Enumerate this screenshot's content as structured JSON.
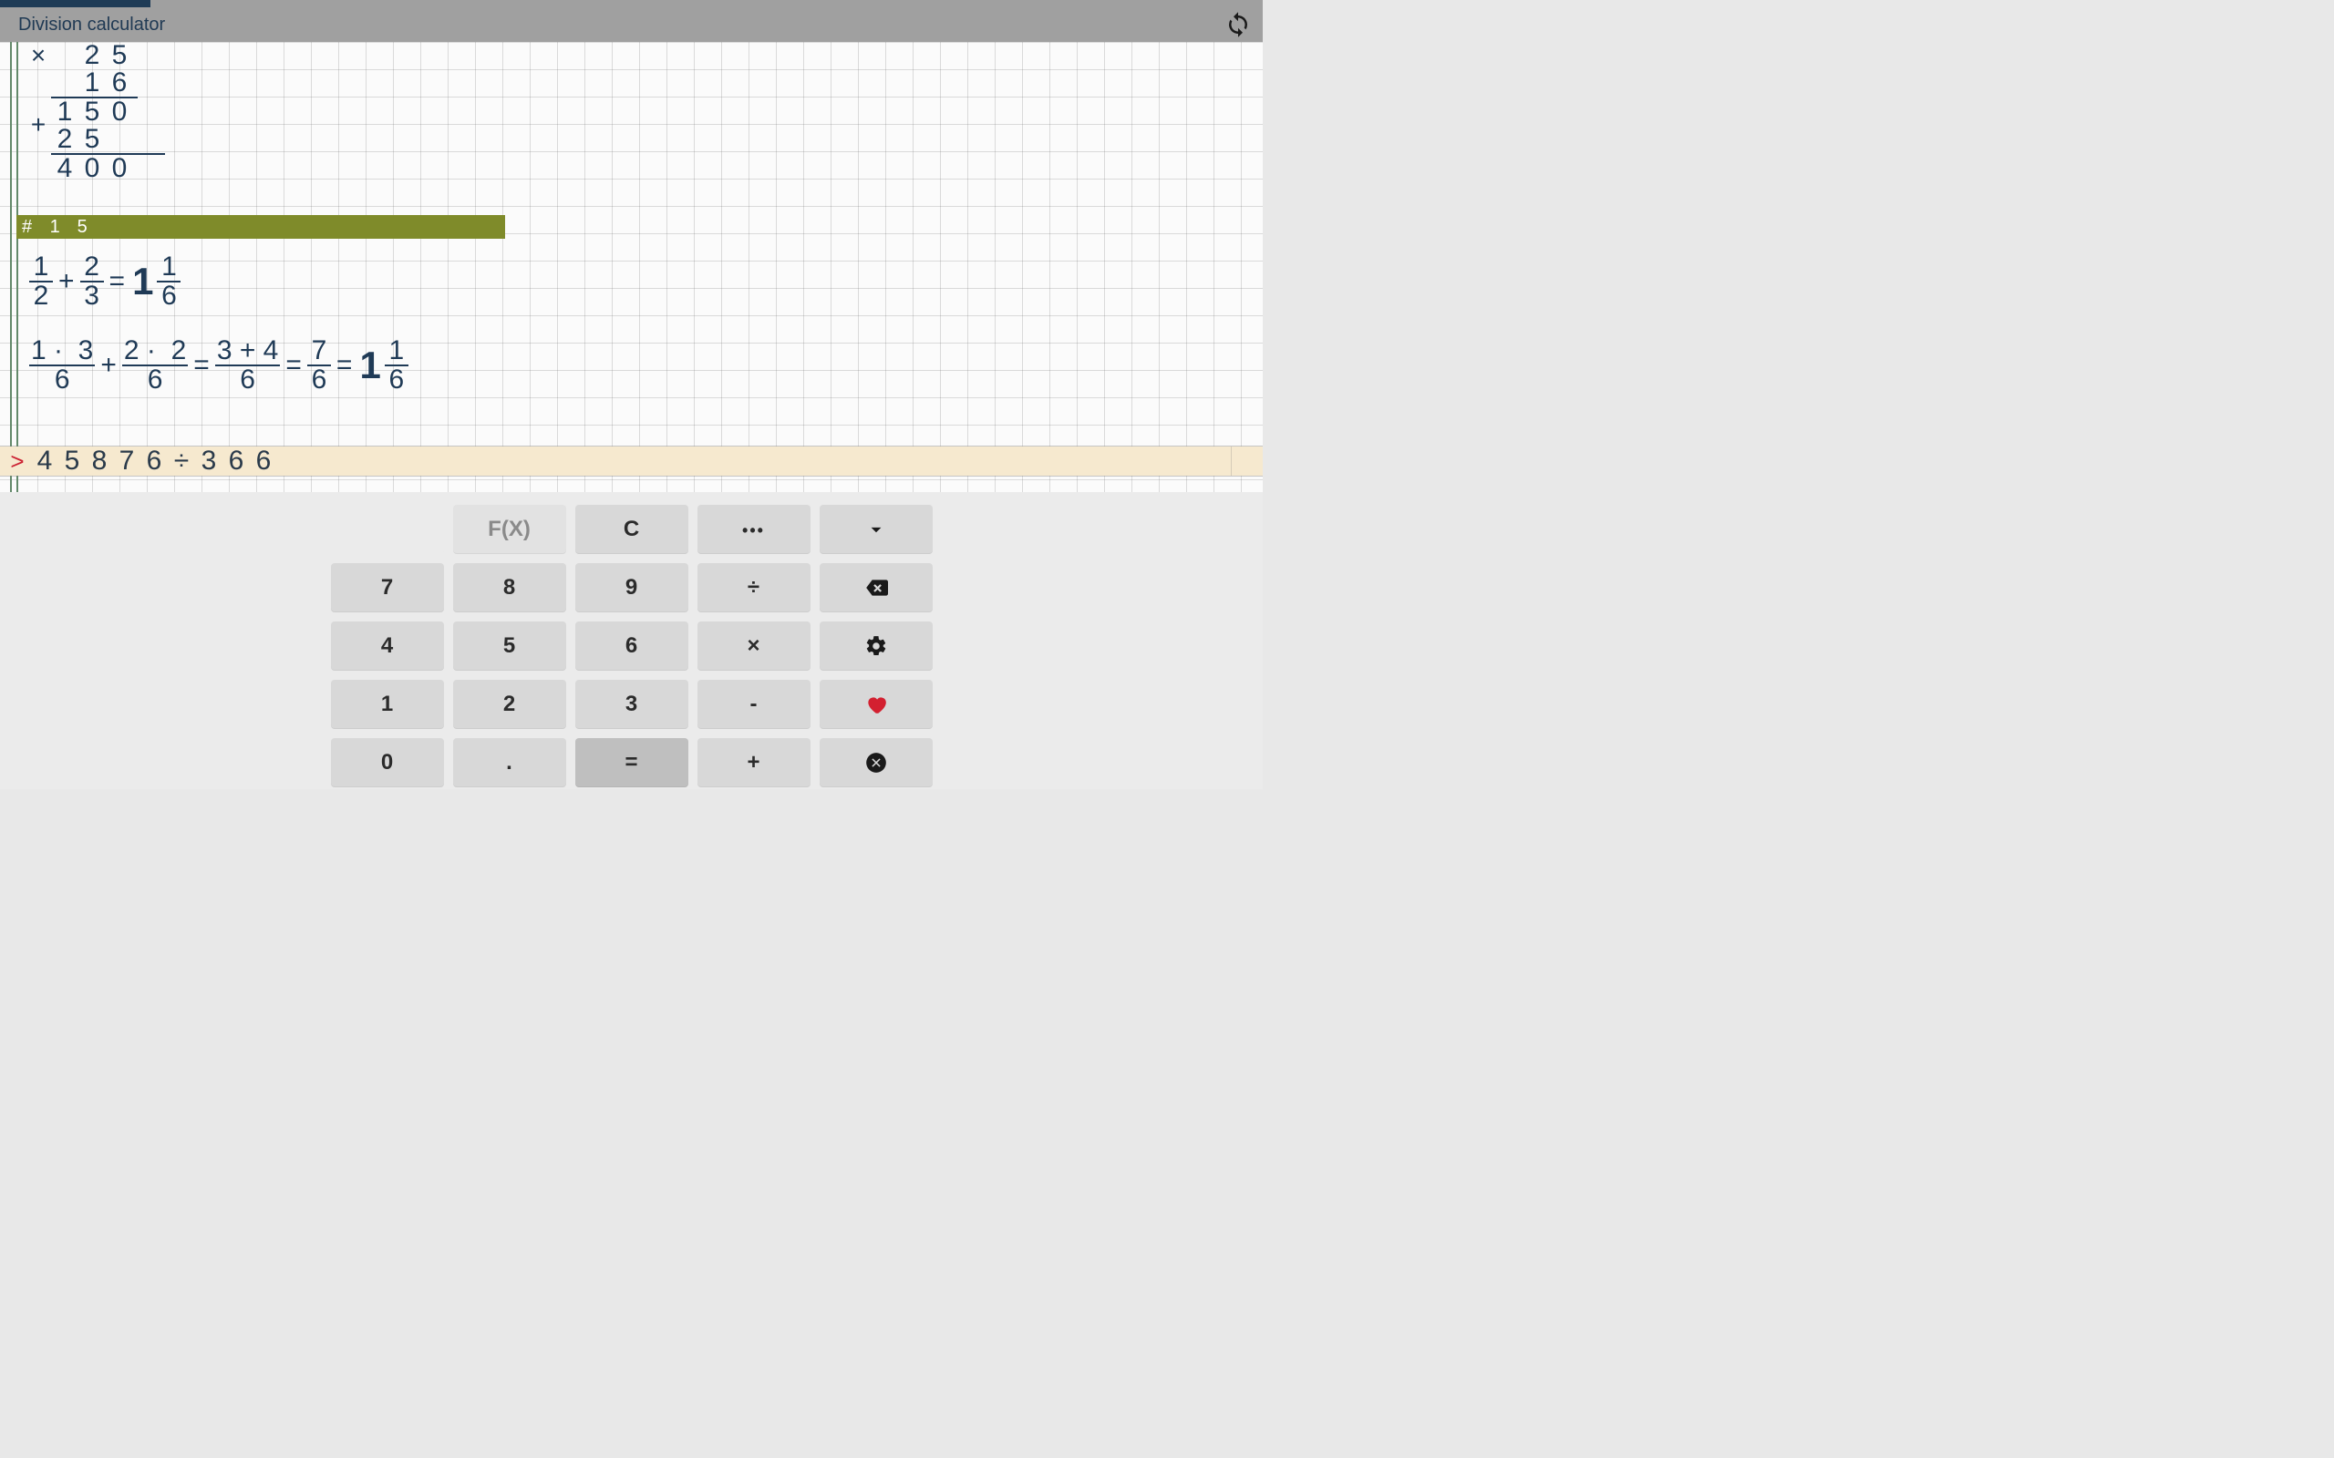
{
  "header": {
    "title": "Division calculator"
  },
  "multiplication": {
    "operand_top": [
      "2",
      "5"
    ],
    "operand_bottom": [
      "1",
      "6"
    ],
    "operator_top": "×",
    "partial1": [
      "1",
      "5",
      "0"
    ],
    "partial2": [
      "2",
      "5"
    ],
    "operator_mid": "+",
    "result": [
      "4",
      "0",
      "0"
    ]
  },
  "banner": {
    "hash": "#",
    "digits": [
      "1",
      "5"
    ]
  },
  "frac1": {
    "a": {
      "n": "1",
      "d": "2"
    },
    "op1": "+",
    "b": {
      "n": "2",
      "d": "3"
    },
    "eq": "=",
    "whole": "1",
    "r": {
      "n": "1",
      "d": "6"
    }
  },
  "frac2": {
    "a": {
      "n": "1 ·  3",
      "d": "6"
    },
    "op1": "+",
    "b": {
      "n": "2 ·  2",
      "d": "6"
    },
    "eq1": "=",
    "c": {
      "n": "3 + 4",
      "d": "6"
    },
    "eq2": "=",
    "dfrac": {
      "n": "7",
      "d": "6"
    },
    "eq3": "=",
    "whole": "1",
    "r": {
      "n": "1",
      "d": "6"
    }
  },
  "input": {
    "prompt": ">",
    "chars": [
      "4",
      "5",
      "8",
      "7",
      "6",
      "÷",
      "3",
      "6",
      "6"
    ]
  },
  "keypad": {
    "row1": [
      {
        "label": "",
        "blank": true
      },
      {
        "label": "F(X)",
        "name": "function-key",
        "muted": true
      },
      {
        "label": "C",
        "name": "clear-key"
      },
      {
        "label": "...",
        "name": "more-key",
        "dots": true
      },
      {
        "label": "",
        "name": "collapse-key",
        "chev": true
      },
      null
    ],
    "rows": [
      [
        {
          "label": "7",
          "name": "digit-7"
        },
        {
          "label": "8",
          "name": "digit-8"
        },
        {
          "label": "9",
          "name": "digit-9"
        },
        {
          "label": "÷",
          "name": "divide-key"
        },
        {
          "label": "",
          "name": "backspace-key",
          "back": true
        }
      ],
      [
        {
          "label": "4",
          "name": "digit-4"
        },
        {
          "label": "5",
          "name": "digit-5"
        },
        {
          "label": "6",
          "name": "digit-6"
        },
        {
          "label": "×",
          "name": "multiply-key"
        },
        {
          "label": "",
          "name": "settings-key",
          "gear": true
        }
      ],
      [
        {
          "label": "1",
          "name": "digit-1"
        },
        {
          "label": "2",
          "name": "digit-2"
        },
        {
          "label": "3",
          "name": "digit-3"
        },
        {
          "label": "-",
          "name": "minus-key"
        },
        {
          "label": "",
          "name": "favorite-key",
          "heart": true
        }
      ],
      [
        {
          "label": "0",
          "name": "digit-0"
        },
        {
          "label": ".",
          "name": "decimal-key"
        },
        {
          "label": "=",
          "name": "equals-key",
          "equals": true
        },
        {
          "label": "+",
          "name": "plus-key"
        },
        {
          "label": "",
          "name": "close-key",
          "xcircle": true
        }
      ]
    ]
  }
}
